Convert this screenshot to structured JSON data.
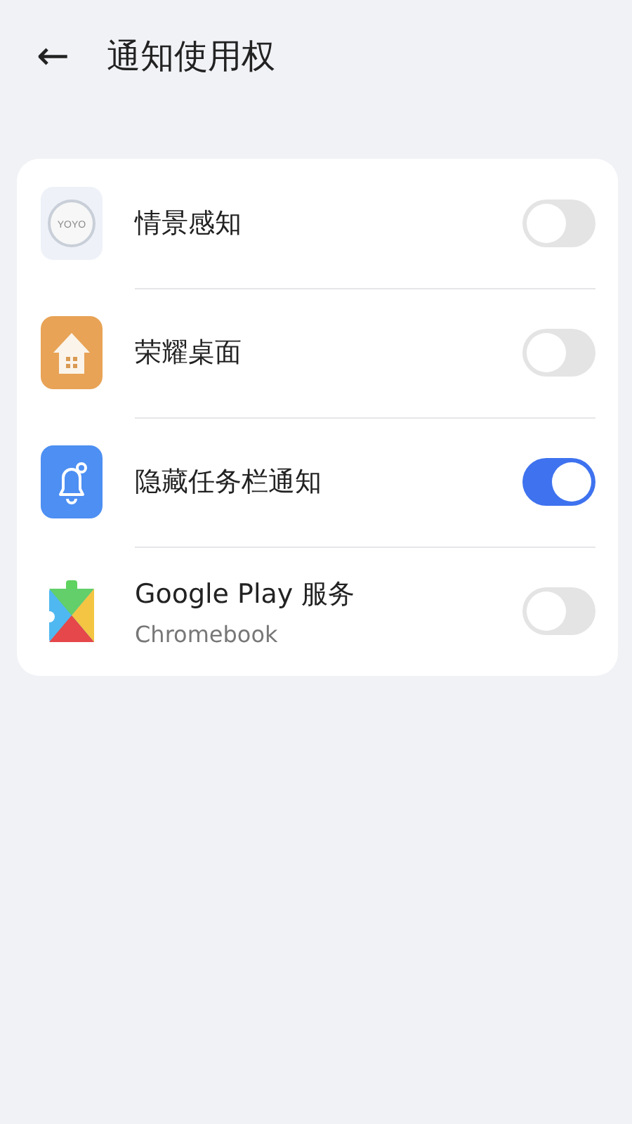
{
  "header": {
    "back": "←",
    "title": "通知使用权"
  },
  "apps": [
    {
      "kind": "orb",
      "logo_text": "YOYO",
      "name": "情景感知",
      "on": false
    },
    {
      "kind": "house",
      "name": "荣耀桌面",
      "on": false
    },
    {
      "kind": "bell",
      "name": "隐藏任务栏通知",
      "on": true
    },
    {
      "kind": "puzzle",
      "name": "Google Play 服务",
      "subtitle": "Chromebook",
      "on": false
    }
  ]
}
